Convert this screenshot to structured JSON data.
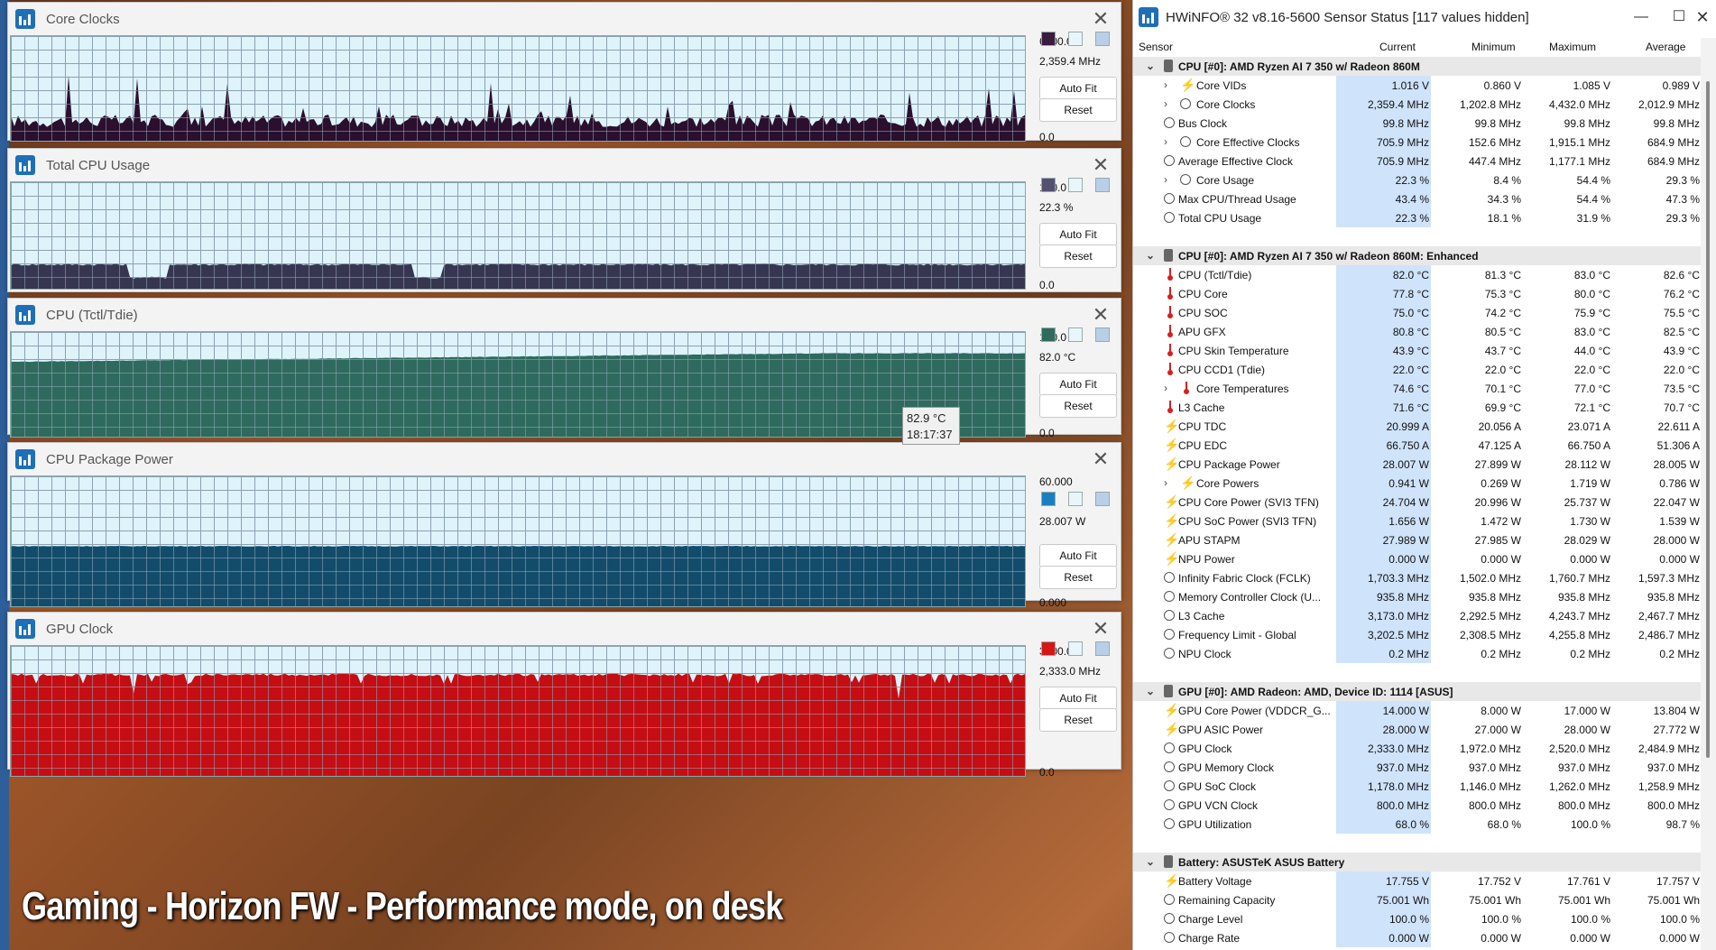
{
  "graphs": [
    {
      "title": "Core Clocks",
      "max": "6000.0",
      "current": "2,359.4 MHz",
      "min": "0.0",
      "autofit": "Auto Fit",
      "reset": "Reset",
      "color": "#2a0f2e",
      "level": 0.18,
      "spike": 0.45,
      "swatch": "#3a1a3f"
    },
    {
      "title": "Total CPU Usage",
      "max": "100.0",
      "current": "22.3 %",
      "min": "0.0",
      "autofit": "Auto Fit",
      "reset": "Reset",
      "color": "#373650",
      "level": 0.24,
      "spike": 0.0,
      "swatch": "#545070"
    },
    {
      "title": "CPU (Tctl/Tdie)",
      "max": "100.0",
      "current": "82.0 °C",
      "min": "0.0",
      "autofit": "Auto Fit",
      "reset": "Reset",
      "color": "#2f6a5e",
      "level": 0.78,
      "spike": 0.0,
      "swatch": "#2f6a5e"
    },
    {
      "title": "CPU Package Power",
      "max": "60.000",
      "current": "28.007 W",
      "min": "0.000",
      "autofit": "Auto Fit",
      "reset": "Reset",
      "color": "#134c6b",
      "level": 0.47,
      "spike": 0.0,
      "swatch": "#1a7fc0"
    },
    {
      "title": "GPU Clock",
      "max": "3000.0",
      "current": "2,333.0 MHz",
      "min": "0.0",
      "autofit": "Auto Fit",
      "reset": "Reset",
      "color": "#c40e14",
      "level": 0.78,
      "spike": 0.0,
      "swatch": "#d41616"
    }
  ],
  "tooltip": {
    "value": "82.9 °C",
    "time": "18:17:37"
  },
  "caption": "Gaming - Horizon FW - Performance mode, on desk",
  "hwinfo": {
    "title": "HWiNFO® 32 v8.16-5600 Sensor Status [117 values hidden]",
    "columns": [
      "Sensor",
      "Current",
      "Minimum",
      "Maximum",
      "Average"
    ],
    "rows": [
      {
        "type": "group",
        "label": "CPU [#0]: AMD Ryzen AI 7 350 w/ Radeon 860M"
      },
      {
        "icon": "volt",
        "indent": true,
        "expand": true,
        "label": "Core VIDs",
        "cur": "1.016 V",
        "min": "0.860 V",
        "max": "1.085 V",
        "avg": "0.989 V"
      },
      {
        "icon": "clk",
        "indent": true,
        "expand": true,
        "label": "Core Clocks",
        "cur": "2,359.4 MHz",
        "min": "1,202.8 MHz",
        "max": "4,432.0 MHz",
        "avg": "2,012.9 MHz"
      },
      {
        "icon": "clk",
        "label": "Bus Clock",
        "cur": "99.8 MHz",
        "min": "99.8 MHz",
        "max": "99.8 MHz",
        "avg": "99.8 MHz"
      },
      {
        "icon": "clk",
        "indent": true,
        "expand": true,
        "label": "Core Effective Clocks",
        "cur": "705.9 MHz",
        "min": "152.6 MHz",
        "max": "1,915.1 MHz",
        "avg": "684.9 MHz"
      },
      {
        "icon": "clk",
        "label": "Average Effective Clock",
        "cur": "705.9 MHz",
        "min": "447.4 MHz",
        "max": "1,177.1 MHz",
        "avg": "684.9 MHz"
      },
      {
        "icon": "clk",
        "indent": true,
        "expand": true,
        "label": "Core Usage",
        "cur": "22.3 %",
        "min": "8.4 %",
        "max": "54.4 %",
        "avg": "29.3 %"
      },
      {
        "icon": "clk",
        "label": "Max CPU/Thread Usage",
        "cur": "43.4 %",
        "min": "34.3 %",
        "max": "54.4 %",
        "avg": "47.3 %"
      },
      {
        "icon": "clk",
        "label": "Total CPU Usage",
        "cur": "22.3 %",
        "min": "18.1 %",
        "max": "31.9 %",
        "avg": "29.3 %"
      },
      {
        "type": "spacer"
      },
      {
        "type": "group",
        "label": "CPU [#0]: AMD Ryzen AI 7 350 w/ Radeon 860M: Enhanced"
      },
      {
        "icon": "temp",
        "label": "CPU (Tctl/Tdie)",
        "cur": "82.0 °C",
        "min": "81.3 °C",
        "max": "83.0 °C",
        "avg": "82.6 °C"
      },
      {
        "icon": "temp",
        "label": "CPU Core",
        "cur": "77.8 °C",
        "min": "75.3 °C",
        "max": "80.0 °C",
        "avg": "76.2 °C"
      },
      {
        "icon": "temp",
        "label": "CPU SOC",
        "cur": "75.0 °C",
        "min": "74.2 °C",
        "max": "75.9 °C",
        "avg": "75.5 °C"
      },
      {
        "icon": "temp",
        "label": "APU GFX",
        "cur": "80.8 °C",
        "min": "80.5 °C",
        "max": "83.0 °C",
        "avg": "82.5 °C"
      },
      {
        "icon": "temp",
        "label": "CPU Skin Temperature",
        "cur": "43.9 °C",
        "min": "43.7 °C",
        "max": "44.0 °C",
        "avg": "43.9 °C"
      },
      {
        "icon": "temp",
        "label": "CPU CCD1 (Tdie)",
        "cur": "22.0 °C",
        "min": "22.0 °C",
        "max": "22.0 °C",
        "avg": "22.0 °C"
      },
      {
        "icon": "temp",
        "indent": true,
        "expand": true,
        "label": "Core Temperatures",
        "cur": "74.6 °C",
        "min": "70.1 °C",
        "max": "77.0 °C",
        "avg": "73.5 °C"
      },
      {
        "icon": "temp",
        "label": "L3 Cache",
        "cur": "71.6 °C",
        "min": "69.9 °C",
        "max": "72.1 °C",
        "avg": "70.7 °C"
      },
      {
        "icon": "volt",
        "label": "CPU TDC",
        "cur": "20.999 A",
        "min": "20.056 A",
        "max": "23.071 A",
        "avg": "22.611 A"
      },
      {
        "icon": "volt",
        "label": "CPU EDC",
        "cur": "66.750 A",
        "min": "47.125 A",
        "max": "66.750 A",
        "avg": "51.306 A"
      },
      {
        "icon": "volt",
        "label": "CPU Package Power",
        "cur": "28.007 W",
        "min": "27.899 W",
        "max": "28.112 W",
        "avg": "28.005 W"
      },
      {
        "icon": "volt",
        "indent": true,
        "expand": true,
        "label": "Core Powers",
        "cur": "0.941 W",
        "min": "0.269 W",
        "max": "1.719 W",
        "avg": "0.786 W"
      },
      {
        "icon": "volt",
        "label": "CPU Core Power (SVI3 TFN)",
        "cur": "24.704 W",
        "min": "20.996 W",
        "max": "25.737 W",
        "avg": "22.047 W"
      },
      {
        "icon": "volt",
        "label": "CPU SoC Power (SVI3 TFN)",
        "cur": "1.656 W",
        "min": "1.472 W",
        "max": "1.730 W",
        "avg": "1.539 W"
      },
      {
        "icon": "volt",
        "label": "APU STAPM",
        "cur": "27.989 W",
        "min": "27.985 W",
        "max": "28.029 W",
        "avg": "28.000 W"
      },
      {
        "icon": "volt",
        "label": "NPU Power",
        "cur": "0.000 W",
        "min": "0.000 W",
        "max": "0.000 W",
        "avg": "0.000 W"
      },
      {
        "icon": "clk",
        "label": "Infinity Fabric Clock (FCLK)",
        "cur": "1,703.3 MHz",
        "min": "1,502.0 MHz",
        "max": "1,760.7 MHz",
        "avg": "1,597.3 MHz"
      },
      {
        "icon": "clk",
        "label": "Memory Controller Clock (U...",
        "cur": "935.8 MHz",
        "min": "935.8 MHz",
        "max": "935.8 MHz",
        "avg": "935.8 MHz"
      },
      {
        "icon": "clk",
        "label": "L3 Cache",
        "cur": "3,173.0 MHz",
        "min": "2,292.5 MHz",
        "max": "4,243.7 MHz",
        "avg": "2,467.7 MHz"
      },
      {
        "icon": "clk",
        "label": "Frequency Limit - Global",
        "cur": "3,202.5 MHz",
        "min": "2,308.5 MHz",
        "max": "4,255.8 MHz",
        "avg": "2,486.7 MHz"
      },
      {
        "icon": "clk",
        "label": "NPU Clock",
        "cur": "0.2 MHz",
        "min": "0.2 MHz",
        "max": "0.2 MHz",
        "avg": "0.2 MHz"
      },
      {
        "type": "spacer"
      },
      {
        "type": "group",
        "label": "GPU [#0]: AMD Radeon: AMD, Device ID: 1114 [ASUS]"
      },
      {
        "icon": "volt",
        "label": "GPU Core Power (VDDCR_G...",
        "cur": "14.000 W",
        "min": "8.000 W",
        "max": "17.000 W",
        "avg": "13.804 W"
      },
      {
        "icon": "volt",
        "label": "GPU ASIC Power",
        "cur": "28.000 W",
        "min": "27.000 W",
        "max": "28.000 W",
        "avg": "27.772 W"
      },
      {
        "icon": "clk",
        "label": "GPU Clock",
        "cur": "2,333.0 MHz",
        "min": "1,972.0 MHz",
        "max": "2,520.0 MHz",
        "avg": "2,484.9 MHz"
      },
      {
        "icon": "clk",
        "label": "GPU Memory Clock",
        "cur": "937.0 MHz",
        "min": "937.0 MHz",
        "max": "937.0 MHz",
        "avg": "937.0 MHz"
      },
      {
        "icon": "clk",
        "label": "GPU SoC Clock",
        "cur": "1,178.0 MHz",
        "min": "1,146.0 MHz",
        "max": "1,262.0 MHz",
        "avg": "1,258.9 MHz"
      },
      {
        "icon": "clk",
        "label": "GPU VCN Clock",
        "cur": "800.0 MHz",
        "min": "800.0 MHz",
        "max": "800.0 MHz",
        "avg": "800.0 MHz"
      },
      {
        "icon": "clk",
        "label": "GPU Utilization",
        "cur": "68.0 %",
        "min": "68.0 %",
        "max": "100.0 %",
        "avg": "98.7 %"
      },
      {
        "type": "spacer"
      },
      {
        "type": "group",
        "label": "Battery: ASUSTeK ASUS Battery"
      },
      {
        "icon": "volt",
        "label": "Battery Voltage",
        "cur": "17.755 V",
        "min": "17.752 V",
        "max": "17.761 V",
        "avg": "17.757 V"
      },
      {
        "icon": "clk",
        "label": "Remaining Capacity",
        "cur": "75.001 Wh",
        "min": "75.001 Wh",
        "max": "75.001 Wh",
        "avg": "75.001 Wh"
      },
      {
        "icon": "clk",
        "label": "Charge Level",
        "cur": "100.0 %",
        "min": "100.0 %",
        "max": "100.0 %",
        "avg": "100.0 %"
      },
      {
        "icon": "clk",
        "label": "Charge Rate",
        "cur": "0.000 W",
        "min": "0.000 W",
        "max": "0.000 W",
        "avg": "0.000 W"
      }
    ]
  }
}
